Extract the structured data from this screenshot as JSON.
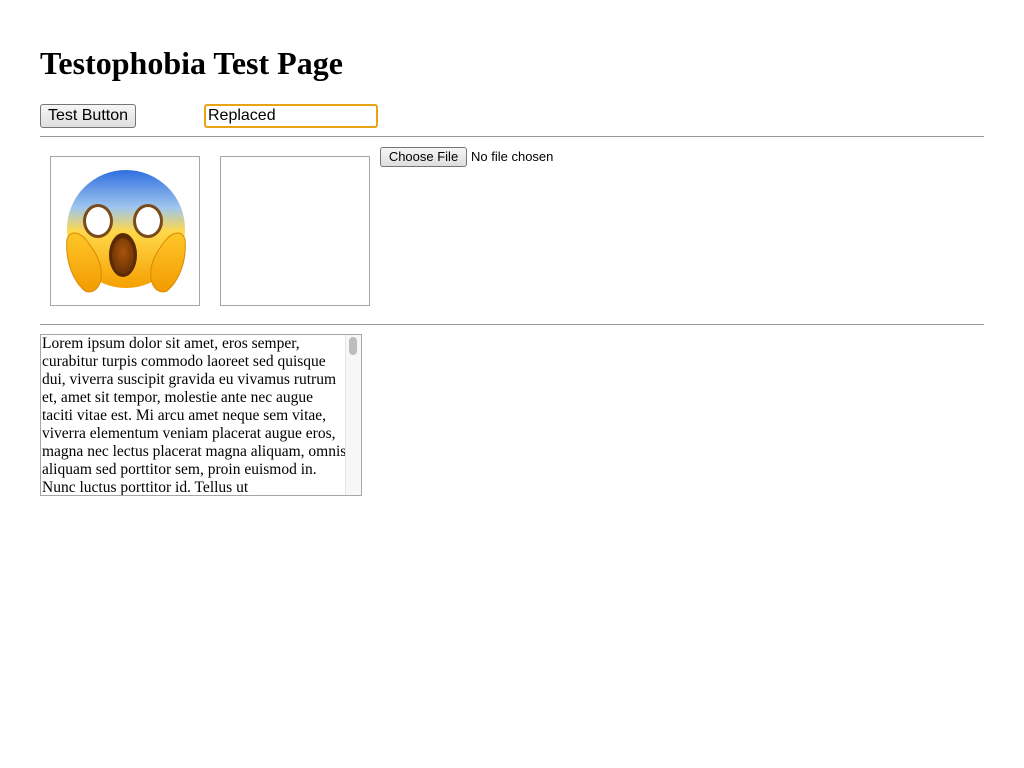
{
  "page": {
    "title": "Testophobia Test Page"
  },
  "controls": {
    "test_button_label": "Test Button",
    "text_input_value": "Replaced",
    "accent_color": "#e8a317"
  },
  "images": [
    {
      "name": "screaming-face-emoji",
      "icon": "face-screaming-in-fear"
    },
    {
      "name": "empty-image",
      "icon": ""
    }
  ],
  "file_input": {
    "button_label": "Choose File",
    "status_text": "No file chosen"
  },
  "textarea": {
    "text": "Lorem ipsum dolor sit amet, eros semper, curabitur turpis commodo laoreet sed quisque dui, viverra suscipit gravida eu vivamus rutrum et, amet sit tempor, molestie ante nec augue taciti vitae est. Mi arcu amet neque sem vitae, viverra elementum veniam placerat augue eros, magna nec lectus placerat magna aliquam, omnis aliquam sed porttitor sem, proin euismod in. Nunc luctus porttitor id. Tellus ut"
  }
}
